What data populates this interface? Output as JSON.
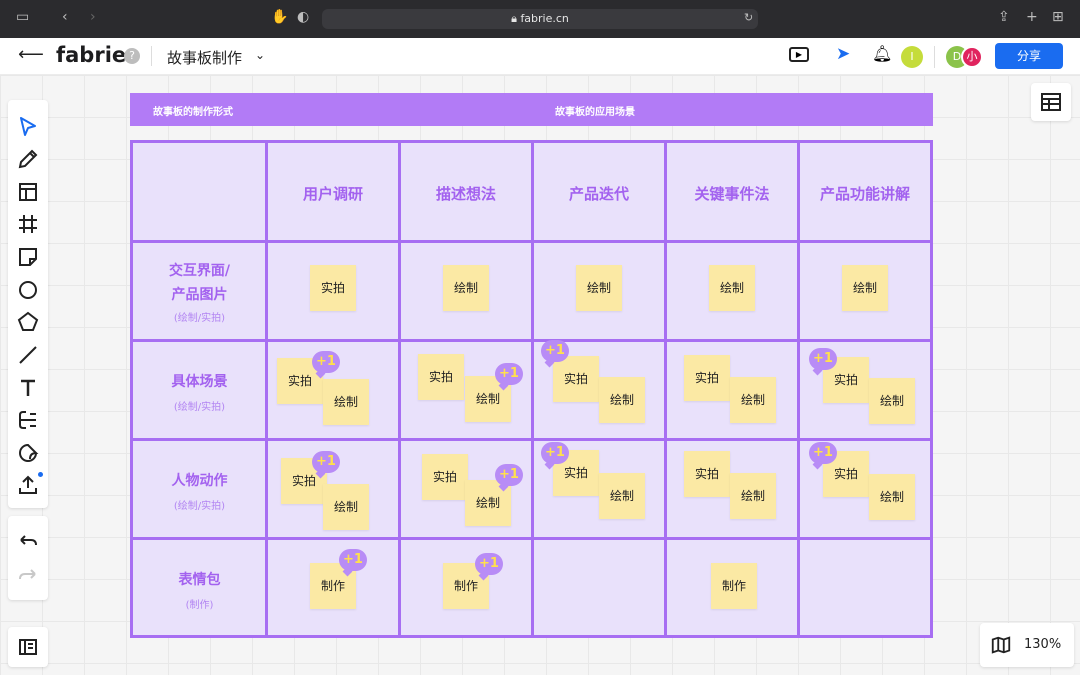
{
  "browser": {
    "url": "fabrie.cn"
  },
  "header": {
    "logo": "fabrie",
    "help": "?",
    "doc_title": "故事板制作",
    "avatar_1": "I",
    "avatar_2": "D",
    "avatar_3": "小",
    "share_label": "分享"
  },
  "zoom": "130%",
  "banner": {
    "left": "故事板的制作形式",
    "center": "故事板的应用场景"
  },
  "columns": [
    "用户调研",
    "描述想法",
    "产品迭代",
    "关键事件法",
    "产品功能讲解"
  ],
  "rows": [
    {
      "title_1": "交互界面/",
      "title_2": "产品图片",
      "sub": "(绘制/实拍)"
    },
    {
      "title_1": "具体场景",
      "sub": "(绘制/实拍)"
    },
    {
      "title_1": "人物动作",
      "sub": "(绘制/实拍)"
    },
    {
      "title_1": "表情包",
      "sub": "(制作)"
    }
  ],
  "notes": {
    "shoot": "实拍",
    "draw": "绘制",
    "make": "制作",
    "plus_one": "+1"
  },
  "colors": {
    "accent": "#a76ef2",
    "banner": "#b27bf6",
    "note": "#fbe9a4",
    "share": "#1a6cf0"
  }
}
